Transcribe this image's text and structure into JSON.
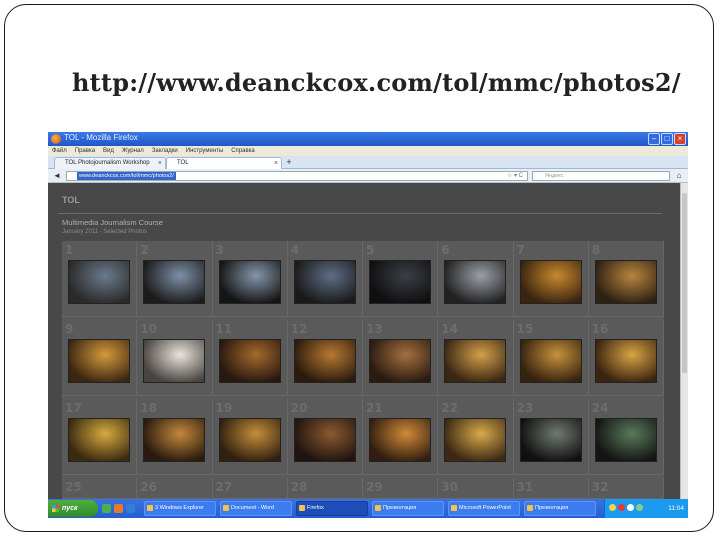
{
  "slide": {
    "title": "http://www.deanckcox.com/tol/mmc/photos2/"
  },
  "browser": {
    "window_title": "TOL - Mozilla Firefox",
    "menu": [
      "Файл",
      "Правка",
      "Вид",
      "Журнал",
      "Закладки",
      "Инструменты",
      "Справка"
    ],
    "tabs": [
      {
        "label": "TOL Photojournalism Workshop"
      },
      {
        "label": "TOL"
      }
    ],
    "url": "www.deanckcox.com/tol/mmc/photos2/",
    "search_placeholder": "Яндекс"
  },
  "gallery": {
    "site_logo": "TOL",
    "course_title": "Multimedia Journalism Course",
    "course_subtitle": "January 2011 - Selected Photos",
    "photo_numbers": [
      "1",
      "2",
      "3",
      "4",
      "5",
      "6",
      "7",
      "8",
      "9",
      "10",
      "11",
      "12",
      "13",
      "14",
      "15",
      "16",
      "17",
      "18",
      "19",
      "20",
      "21",
      "22",
      "23",
      "24",
      "25",
      "26",
      "27",
      "28",
      "29",
      "30",
      "31",
      "32"
    ],
    "thumb_colors": [
      [
        "#2a2a2a",
        "#6a7a8c"
      ],
      [
        "#1c1c1c",
        "#7d8fa6"
      ],
      [
        "#151515",
        "#8496a8"
      ],
      [
        "#1a1a1a",
        "#5d6e85"
      ],
      [
        "#0f0f0f",
        "#3a3f47"
      ],
      [
        "#222222",
        "#9aa0a8"
      ],
      [
        "#3a2410",
        "#c8892e"
      ],
      [
        "#2e2214",
        "#b8853e"
      ],
      [
        "#3c2612",
        "#d49a3c"
      ],
      [
        "#4a4440",
        "#e8e4dc"
      ],
      [
        "#281810",
        "#a4692a"
      ],
      [
        "#2c1a0e",
        "#b77a32"
      ],
      [
        "#2a1a10",
        "#a47040"
      ],
      [
        "#3a2612",
        "#d2a04a"
      ],
      [
        "#36220e",
        "#c6923c"
      ],
      [
        "#3a2410",
        "#d9a445"
      ],
      [
        "#3a2a10",
        "#d6aa3e"
      ],
      [
        "#2a1a0e",
        "#c2883a"
      ],
      [
        "#302010",
        "#c48e3a"
      ],
      [
        "#201410",
        "#8a5a30"
      ],
      [
        "#321e10",
        "#d08a38"
      ],
      [
        "#3c2814",
        "#d8aa4a"
      ],
      [
        "#101010",
        "#707a70"
      ],
      [
        "#141414",
        "#5a7a5a"
      ]
    ]
  },
  "taskbar": {
    "start_label": "пуск",
    "buttons": [
      "3 Windows Explorer",
      "Document - Word",
      "Firefox",
      "Презентация",
      "Microsoft PowerPoint",
      "Презентация"
    ],
    "clock": "11:04"
  }
}
